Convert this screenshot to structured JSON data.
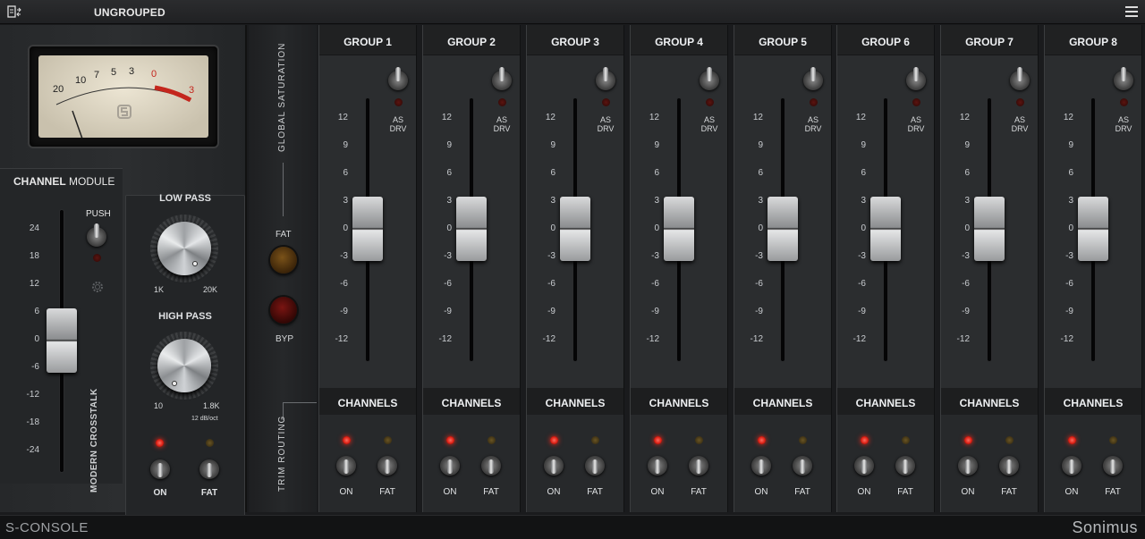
{
  "topbar": {
    "preset": "UNGROUPED"
  },
  "vu_meter": {
    "scale": [
      "20",
      "10",
      "7",
      "5",
      "3",
      "0",
      "3"
    ]
  },
  "channel_module": {
    "title_bold": "CHANNEL",
    "title_rest": " MODULE",
    "push_label": "PUSH",
    "scale": [
      "24",
      "18",
      "12",
      "6",
      "0",
      "-6",
      "-12",
      "-18",
      "-24"
    ],
    "crosstalk_label": "MODERN CROSSTALK",
    "low_pass": {
      "label": "LOW PASS",
      "min": "1K",
      "max": "20K"
    },
    "high_pass": {
      "label": "HIGH PASS",
      "min": "10",
      "max": "1.8K",
      "slope": "12 dB/oct"
    },
    "on_label": "ON",
    "fat_label": "FAT"
  },
  "center": {
    "global_saturation": "GLOBAL SATURATION",
    "fat_label": "FAT",
    "byp_label": "BYP",
    "trim_routing": "TRIM ROUTING"
  },
  "groups": {
    "scale": [
      "12",
      "9",
      "6",
      "3",
      "0",
      "-3",
      "-6",
      "-9",
      "-12"
    ],
    "as_drv": [
      "AS",
      "DRV"
    ],
    "channels_label": "CHANNELS",
    "on_label": "ON",
    "fat_label": "FAT",
    "names": [
      "GROUP 1",
      "GROUP 2",
      "GROUP 3",
      "GROUP 4",
      "GROUP 5",
      "GROUP 6",
      "GROUP 7",
      "GROUP 8"
    ]
  },
  "footer": {
    "product": "S-CONSOLE",
    "brand": "Sonimus"
  },
  "colors": {
    "led_on": "#d81b10",
    "vu_red": "#c4261d",
    "panel": "#2b2d2f"
  }
}
